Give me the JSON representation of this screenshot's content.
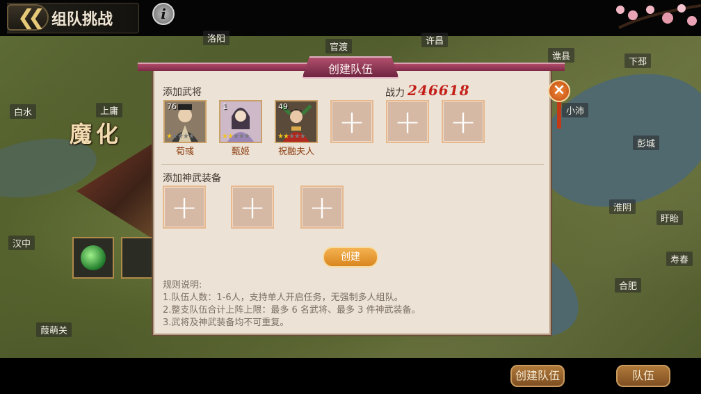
{
  "header": {
    "title": "组队挑战",
    "back_icon": "double-chevron-left-icon",
    "info_icon": "info-icon"
  },
  "map": {
    "labels": [
      "洛阳",
      "官渡",
      "许昌",
      "谯县",
      "下邳",
      "白水",
      "上庸",
      "小沛",
      "彭城",
      "淮阴",
      "盱眙",
      "汉中",
      "寿春",
      "合肥",
      "葭萌关"
    ],
    "stage_title": "魔化"
  },
  "dialog": {
    "title": "创建队伍",
    "add_heroes_label": "添加武将",
    "power_label": "战力",
    "power_value": "246618",
    "heroes": [
      {
        "name": "荀彧",
        "level": "76",
        "stars": 1,
        "max_stars": 5
      },
      {
        "name": "甄姬",
        "level": "1",
        "stars": 2,
        "max_stars": 5
      },
      {
        "name": "祝融夫人",
        "level": "49",
        "stars": 2,
        "max_stars": 5
      }
    ],
    "empty_hero_slots": 3,
    "add_equipment_label": "添加神武装备",
    "empty_equipment_slots": 3,
    "create_label": "创建",
    "rules_title": "规则说明:",
    "rules": [
      "1.队伍人数：1-6人，支持单人开启任务，无强制多人组队。",
      "2.整支队伍合计上阵上限：最多 6 名武将、最多 3 件神武装备。",
      "3.武将及神武装备均不可重复。"
    ]
  },
  "bottom": {
    "create_team_label": "创建队伍",
    "team_label": "队伍"
  },
  "colors": {
    "dialog_bg": "#ece3d6",
    "header": "#9a3a5a",
    "power": "#c4201a",
    "button": "#e9a03a"
  }
}
